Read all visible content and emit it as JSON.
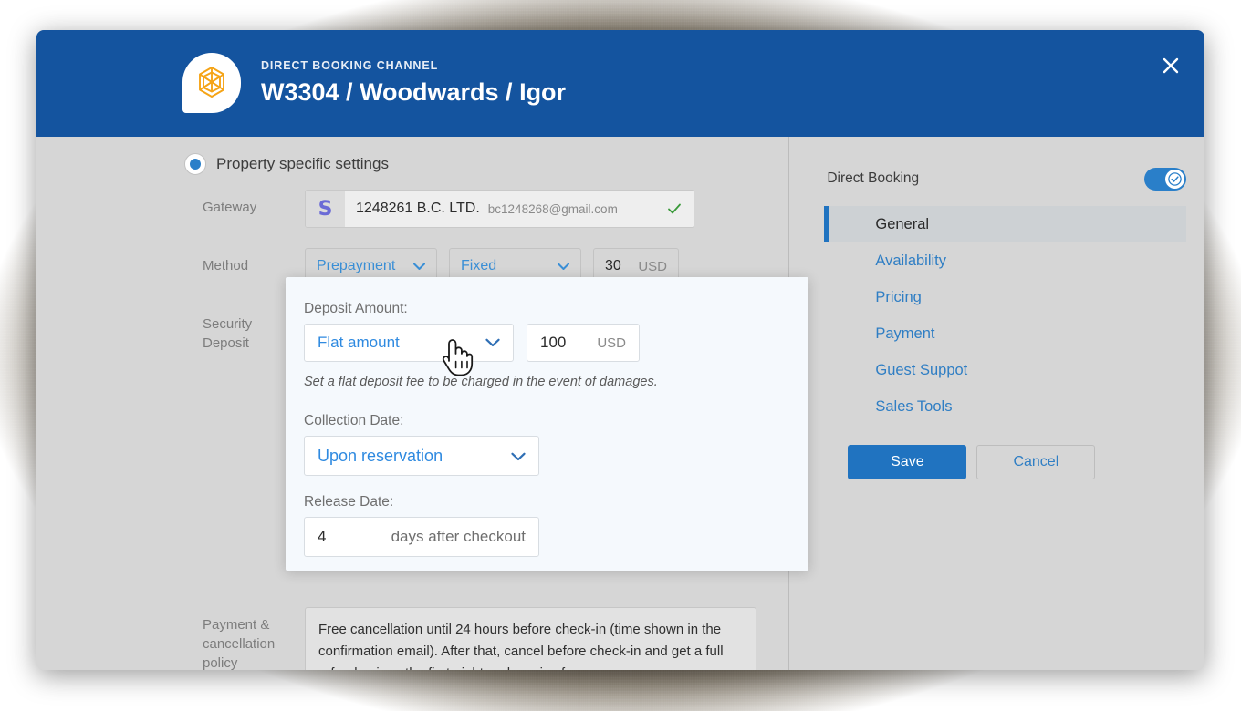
{
  "header": {
    "kicker": "DIRECT BOOKING CHANNEL",
    "title": "W3304 / Woodwards / Igor",
    "close_label": "×",
    "logo_icon": "hostaway-polygon-logo-icon",
    "close_icon": "close-icon",
    "bg_color": "#14549f"
  },
  "main": {
    "property_specific": {
      "label": "Property specific settings",
      "selected": true
    },
    "gateway": {
      "label": "Gateway",
      "badge": "S",
      "badge_icon": "stripe-icon",
      "name": "1248261 B.C. LTD.",
      "email": "bc1248268@gmail.com",
      "status_icon": "check-icon",
      "status_color": "#3a9a3a"
    },
    "method": {
      "label": "Method",
      "type_value": "Prepayment",
      "mode_value": "Fixed",
      "amount_value": "30",
      "currency": "USD"
    },
    "security_deposit": {
      "label_line1": "Security",
      "label_line2": "Deposit"
    },
    "policy": {
      "label_line1": "Payment &",
      "label_line2": "cancellation",
      "label_line3": "policy",
      "text": "Free cancellation until 24 hours before check-in (time shown in the confirmation email). After that, cancel before check-in and get a full refund, minus the first night and service fee."
    }
  },
  "deposit_panel": {
    "amount_label": "Deposit Amount:",
    "amount_type": "Flat amount",
    "amount_value": "100",
    "currency": "USD",
    "hint": "Set a flat deposit fee to be charged in the event of damages.",
    "collection_label": "Collection Date:",
    "collection_value": "Upon reservation",
    "release_label": "Release Date:",
    "release_days": "4",
    "release_unit": "days after checkout",
    "chevron_icon": "chevron-down-icon",
    "panel_color": "#f5f9fd",
    "accent_color": "#2f8ae0"
  },
  "cursor": {
    "icon": "pointing-hand-cursor-icon"
  },
  "sidebar": {
    "direct_booking_label": "Direct Booking",
    "direct_booking_enabled": true,
    "toggle_icon": "check-circle-icon",
    "items": [
      {
        "label": "General",
        "active": true
      },
      {
        "label": "Availability",
        "active": false
      },
      {
        "label": "Pricing",
        "active": false
      },
      {
        "label": "Payment",
        "active": false
      },
      {
        "label": "Guest Suppot",
        "active": false
      },
      {
        "label": "Sales Tools",
        "active": false
      }
    ],
    "save_label": "Save",
    "cancel_label": "Cancel",
    "accent_color": "#2073c0"
  }
}
